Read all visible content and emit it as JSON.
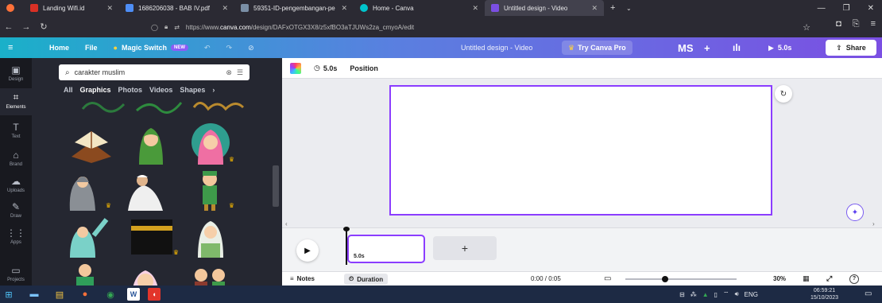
{
  "browser": {
    "tabs": [
      {
        "label": "Landing Wifi.id",
        "color": "#d93025"
      },
      {
        "label": "1686206038 - BAB IV.pdf",
        "color": "#4e8ef7"
      },
      {
        "label": "59351-ID-pengembangan-pe",
        "color": "#7a8fa6"
      },
      {
        "label": "Home - Canva",
        "color": "#00c4cc"
      },
      {
        "label": "Untitled design - Video",
        "color": "#7b4fe3",
        "active": true
      }
    ],
    "url_prefix": "https://www.",
    "url_host": "canva.com",
    "url_path": "/design/DAFxOTGX3X8/z5xfBO3aTJUWs2za_cmyoA/edit"
  },
  "topbar": {
    "home": "Home",
    "file": "File",
    "magic_switch": "Magic Switch",
    "new_badge": "NEW",
    "title": "Untitled design - Video",
    "try_pro": "Try Canva Pro",
    "avatar": "MS",
    "plus": "+",
    "duration": "5.0s",
    "share": "Share"
  },
  "rail": [
    {
      "label": "Design",
      "icon": "▣"
    },
    {
      "label": "Elements",
      "icon": "⌗",
      "active": true
    },
    {
      "label": "Text",
      "icon": "T"
    },
    {
      "label": "Brand",
      "icon": "⌂"
    },
    {
      "label": "Uploads",
      "icon": "☁"
    },
    {
      "label": "Draw",
      "icon": "✎"
    },
    {
      "label": "Apps",
      "icon": "⋮⋮"
    },
    {
      "label": "Projects",
      "icon": "▭"
    }
  ],
  "panel": {
    "search_value": "carakter muslim",
    "filters": [
      "All",
      "Graphics",
      "Photos",
      "Videos",
      "Shapes"
    ],
    "active_filter": "Graphics"
  },
  "context_bar": {
    "duration": "5.0s",
    "position": "Position"
  },
  "timeline": {
    "clip_duration": "5.0s",
    "add_page": "+"
  },
  "footer": {
    "notes": "Notes",
    "duration": "Duration",
    "time": "0:00 / 0:05",
    "zoom": "30%"
  },
  "taskbar": {
    "lang": "ENG",
    "time": "06:59:21",
    "date": "15/10/2023"
  },
  "colors": {
    "accent": "#8b3dff",
    "panel": "#252731",
    "rail": "#18191f"
  }
}
